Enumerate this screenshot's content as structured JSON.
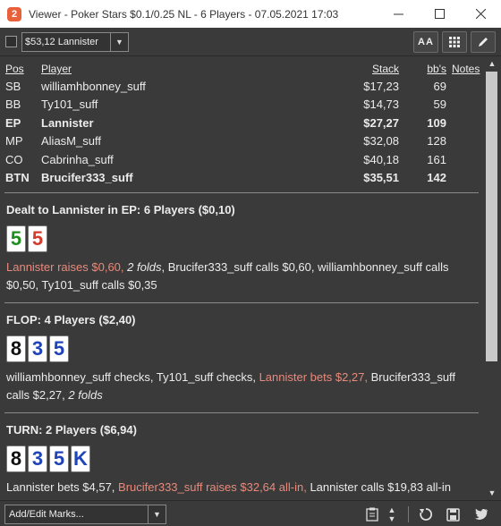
{
  "window": {
    "title": "Viewer - Poker Stars $0.1/0.25 NL - 6 Players - 07.05.2021 17:03",
    "app_icon_letter": "2",
    "minimize_label": "—",
    "maximize_label": "☐",
    "close_label": "✕"
  },
  "toolbar": {
    "player_select_value": "$53,12 Lannister",
    "font_button_label": "AA"
  },
  "table": {
    "headers": {
      "pos": "Pos",
      "player": "Player",
      "stack": "Stack",
      "bbs": "bb's",
      "notes": "Notes"
    },
    "rows": [
      {
        "pos": "SB",
        "player": "williamhbonney_suff",
        "stack": "$17,23",
        "bbs": "69",
        "notes": ""
      },
      {
        "pos": "BB",
        "player": "Ty101_suff",
        "stack": "$14,73",
        "bbs": "59",
        "notes": ""
      },
      {
        "pos": "EP",
        "player": "Lannister",
        "stack": "$27,27",
        "bbs": "109",
        "notes": ""
      },
      {
        "pos": "MP",
        "player": "AliasM_suff",
        "stack": "$32,08",
        "bbs": "128",
        "notes": ""
      },
      {
        "pos": "CO",
        "player": "Cabrinha_suff",
        "stack": "$40,18",
        "bbs": "161",
        "notes": ""
      },
      {
        "pos": "BTN",
        "player": "Brucifer333_suff",
        "stack": "$35,51",
        "bbs": "142",
        "notes": ""
      }
    ]
  },
  "preflop": {
    "header": "Dealt to Lannister in EP: 6 Players ($0,10)",
    "cards": [
      {
        "rank": "5",
        "color": "#1d8f1d"
      },
      {
        "rank": "5",
        "color": "#d33b2c"
      }
    ],
    "hero_action": "Lannister raises $0,60,",
    "folds": "2 folds",
    "rest": ", Brucifer333_suff calls $0,60, williamhbonney_suff calls $0,50, Ty101_suff calls $0,35"
  },
  "flop": {
    "header": "FLOP: 4 Players ($2,40)",
    "cards": [
      {
        "rank": "8",
        "color": "#111111"
      },
      {
        "rank": "3",
        "color": "#1f43b8"
      },
      {
        "rank": "5",
        "color": "#1f43b8"
      }
    ],
    "pre": "williamhbonney_suff checks, Ty101_suff checks,",
    "hero_action": "Lannister bets $2,27,",
    "post": "Brucifer333_suff calls $2,27,",
    "folds": "2 folds"
  },
  "turn": {
    "header": "TURN: 2 Players ($6,94)",
    "cards": [
      {
        "rank": "8",
        "color": "#111111"
      },
      {
        "rank": "3",
        "color": "#1f43b8"
      },
      {
        "rank": "5",
        "color": "#1f43b8"
      },
      {
        "rank": "K",
        "color": "#1f43b8"
      }
    ],
    "pre": "Lannister bets $4,57,",
    "villain_action": "Brucifer333_suff raises $32,64 all-in,",
    "post": "Lannister calls $19,83 all-in"
  },
  "bottom": {
    "marks_select_value": "Add/Edit Marks..."
  },
  "colors": {
    "background": "#3a3a3a",
    "highlight_action": "#e98a7b",
    "app_icon": "#e8613a"
  }
}
